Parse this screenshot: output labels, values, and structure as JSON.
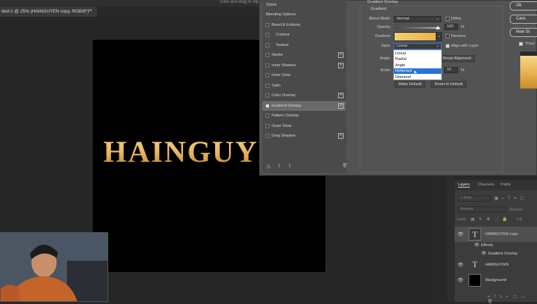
{
  "document": {
    "tab_title": "ded-1 @ 25% (HAINGUYEN copy, RGB/8*) *",
    "close": "×",
    "hint": "Click and drag to rep",
    "canvas_text": "HAINGUYEN"
  },
  "styles_panel": {
    "header": "Styles",
    "items": [
      {
        "label": "Blending Options",
        "checkbox": false,
        "plus": false
      },
      {
        "label": "Bevel & Emboss",
        "checkbox": true,
        "checked": false,
        "plus": false
      },
      {
        "label": "Contour",
        "checkbox": true,
        "checked": false,
        "plus": false,
        "indent": true
      },
      {
        "label": "Texture",
        "checkbox": true,
        "checked": false,
        "plus": false,
        "indent": true
      },
      {
        "label": "Stroke",
        "checkbox": true,
        "checked": false,
        "plus": true
      },
      {
        "label": "Inner Shadow",
        "checkbox": true,
        "checked": false,
        "plus": true
      },
      {
        "label": "Inner Glow",
        "checkbox": true,
        "checked": false,
        "plus": false
      },
      {
        "label": "Satin",
        "checkbox": true,
        "checked": false,
        "plus": false
      },
      {
        "label": "Color Overlay",
        "checkbox": true,
        "checked": false,
        "plus": true
      },
      {
        "label": "Gradient Overlay",
        "checkbox": true,
        "checked": true,
        "plus": true,
        "selected": true
      },
      {
        "label": "Pattern Overlay",
        "checkbox": true,
        "checked": false,
        "plus": false
      },
      {
        "label": "Outer Glow",
        "checkbox": true,
        "checked": false,
        "plus": false
      },
      {
        "label": "Drop Shadow",
        "checkbox": true,
        "checked": false,
        "plus": true
      }
    ],
    "footer": {
      "fx": "fx.",
      "up": "⇧",
      "down": "⇩",
      "trash": "🗑"
    }
  },
  "gradient_overlay": {
    "section_title": "Gradient Overlay",
    "group_title": "Gradient",
    "blend_mode_label": "Blend Mode:",
    "blend_mode": "Normal",
    "dither_label": "Dither",
    "dither": false,
    "opacity_label": "Opacity:",
    "opacity": "100",
    "opacity_unit": "%",
    "gradient_label": "Gradient:",
    "reverse_label": "Reverse",
    "reverse": false,
    "style_label": "Style:",
    "style": "Linear",
    "align_label": "Align with Layer",
    "align": true,
    "angle_label": "Angle:",
    "reset_alignment": "Reset Alignment",
    "scale_label": "Scale:",
    "scale": "10",
    "scale_unit": "%",
    "make_default": "Make Default",
    "reset_default": "Reset to Default",
    "style_options": [
      "Linear",
      "Radial",
      "Angle",
      "Reflected",
      "Diamond"
    ],
    "highlighted_option": "Reflected",
    "gradient_colors": [
      "#f2cf78",
      "#e9b24b"
    ]
  },
  "dialog_buttons": {
    "ok": "Ok",
    "cancel": "Canc",
    "new_style": "New St",
    "preview": "Previ"
  },
  "layers_panel": {
    "tabs": [
      "Layers",
      "Channels",
      "Paths"
    ],
    "kind": "Kind",
    "mode": "Normal",
    "opacity_label": "Opacity:",
    "lock_label": "Lock:",
    "fill_label": "Fill:",
    "layers": [
      {
        "name": "HAINGUYEN copy",
        "thumb": "T",
        "selected": true
      },
      {
        "name": "Effects",
        "sub": true
      },
      {
        "name": "Gradient Overlay",
        "sub": true
      },
      {
        "name": "HAINGUYEN",
        "thumb": "T"
      },
      {
        "name": "Background",
        "thumb": "bg"
      }
    ]
  }
}
